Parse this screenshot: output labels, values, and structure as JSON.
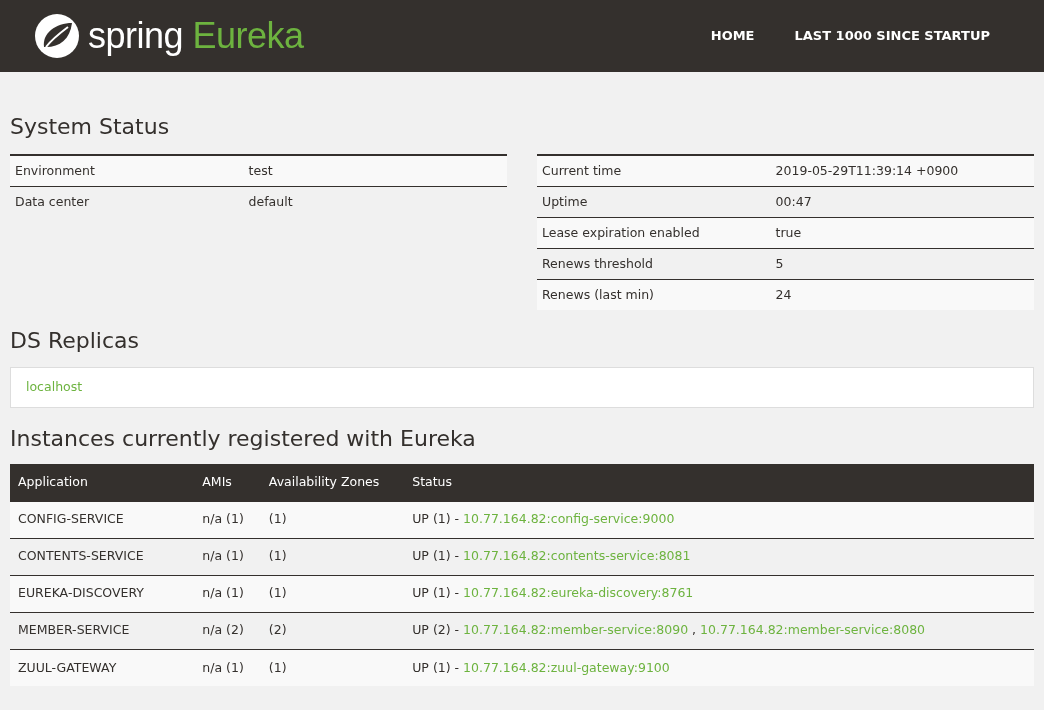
{
  "header": {
    "brand": "spring",
    "product": "Eureka",
    "nav": [
      "HOME",
      "LAST 1000 SINCE STARTUP"
    ]
  },
  "system_status": {
    "title": "System Status",
    "left": [
      {
        "label": "Environment",
        "value": "test"
      },
      {
        "label": "Data center",
        "value": "default"
      }
    ],
    "right": [
      {
        "label": "Current time",
        "value": "2019-05-29T11:39:14 +0900"
      },
      {
        "label": "Uptime",
        "value": "00:47"
      },
      {
        "label": "Lease expiration enabled",
        "value": "true"
      },
      {
        "label": "Renews threshold",
        "value": "5"
      },
      {
        "label": "Renews (last min)",
        "value": "24"
      }
    ]
  },
  "ds_replicas": {
    "title": "DS Replicas",
    "items": [
      "localhost"
    ]
  },
  "instances": {
    "title": "Instances currently registered with Eureka",
    "columns": [
      "Application",
      "AMIs",
      "Availability Zones",
      "Status"
    ],
    "link_separator": ",",
    "rows": [
      {
        "application": "CONFIG-SERVICE",
        "amis": "n/a (1)",
        "zones": "(1)",
        "status": "UP (1) -",
        "links": [
          "10.77.164.82:config-service:9000"
        ]
      },
      {
        "application": "CONTENTS-SERVICE",
        "amis": "n/a (1)",
        "zones": "(1)",
        "status": "UP (1) -",
        "links": [
          "10.77.164.82:contents-service:8081"
        ]
      },
      {
        "application": "EUREKA-DISCOVERY",
        "amis": "n/a (1)",
        "zones": "(1)",
        "status": "UP (1) -",
        "links": [
          "10.77.164.82:eureka-discovery:8761"
        ]
      },
      {
        "application": "MEMBER-SERVICE",
        "amis": "n/a (2)",
        "zones": "(2)",
        "status": "UP (2) -",
        "links": [
          "10.77.164.82:member-service:8090",
          "10.77.164.82:member-service:8080"
        ]
      },
      {
        "application": "ZUUL-GATEWAY",
        "amis": "n/a (1)",
        "zones": "(1)",
        "status": "UP (1) -",
        "links": [
          "10.77.164.82:zuul-gateway:9100"
        ]
      }
    ]
  }
}
